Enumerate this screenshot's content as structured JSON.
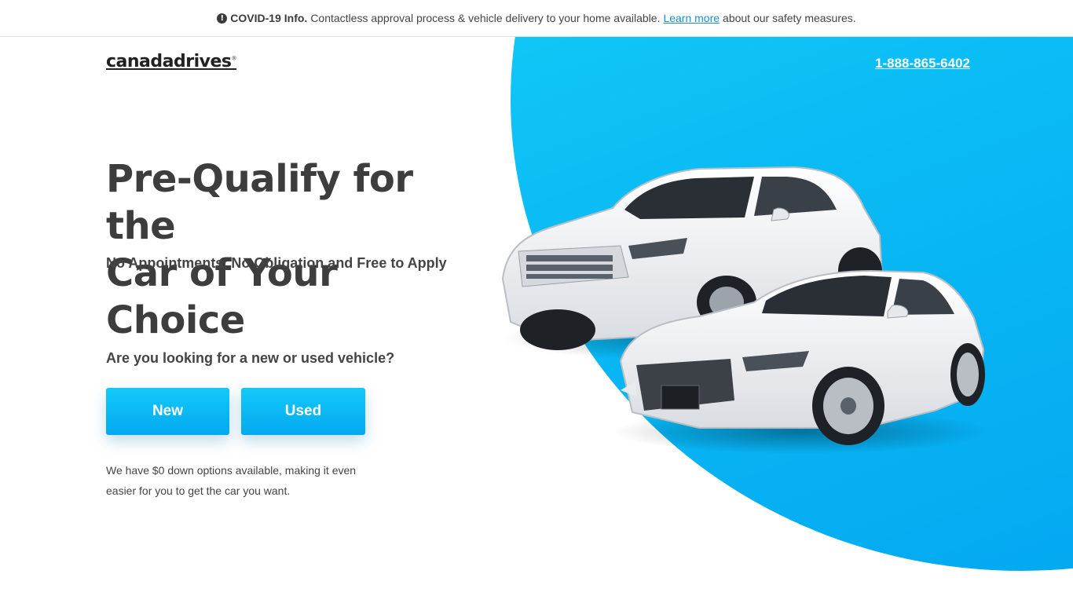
{
  "banner": {
    "icon": "alert-circle-icon",
    "bold_text": "COVID-19 Info.",
    "text_before_link": "Contactless approval process & vehicle delivery to your home available.",
    "link_text": "Learn more",
    "text_after_link": "about our safety measures."
  },
  "header": {
    "logo_text": "canadadrives",
    "logo_mark": "®",
    "phone": "1-888-865-6402"
  },
  "hero": {
    "headline_line1": "Pre-Qualify for the",
    "headline_line2": "Car of Your Choice",
    "subhead": "No Appointments, No Obligation and Free to Apply",
    "question": "Are you looking for a new or used vehicle?",
    "new_button": "New",
    "used_button": "Used",
    "footnote": "We have $0 down options available, making it even easier for you to get the car you want."
  },
  "colors": {
    "accent": "#03a9f0",
    "accent_light": "#1bdcf7",
    "text": "#3d3d3d",
    "link": "#1a8fd8"
  }
}
